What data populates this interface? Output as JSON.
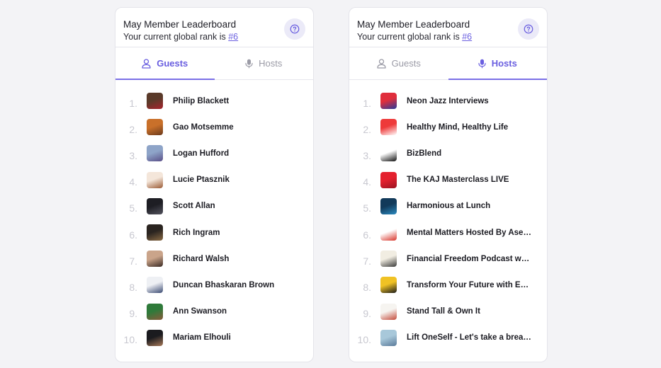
{
  "panels": [
    {
      "title": "May Member Leaderboard",
      "subtitle_prefix": "Your current global rank is ",
      "rank": "#6",
      "tabs": [
        {
          "label": "Guests",
          "icon": "user-icon",
          "active": true
        },
        {
          "label": "Hosts",
          "icon": "microphone-icon",
          "active": false
        }
      ],
      "rows": [
        {
          "rank": "1.",
          "name": "Philip Blackett",
          "avatar_colors": [
            "#5a3a2a",
            "#a8222c"
          ]
        },
        {
          "rank": "2.",
          "name": "Gao Motsemme",
          "avatar_colors": [
            "#c9702a",
            "#6b3a1c"
          ]
        },
        {
          "rank": "3.",
          "name": "Logan Hufford",
          "avatar_colors": [
            "#8ea4c8",
            "#5a4f88"
          ]
        },
        {
          "rank": "4.",
          "name": "Lucie Ptasznik",
          "avatar_colors": [
            "#f4e6da",
            "#9a5a34"
          ]
        },
        {
          "rank": "5.",
          "name": "Scott Allan",
          "avatar_colors": [
            "#1e1e24",
            "#53535e"
          ]
        },
        {
          "rank": "6.",
          "name": "Rich Ingram",
          "avatar_colors": [
            "#2a2420",
            "#8a6a44"
          ]
        },
        {
          "rank": "7.",
          "name": "Richard Walsh",
          "avatar_colors": [
            "#caa48a",
            "#3a2a24"
          ]
        },
        {
          "rank": "8.",
          "name": "Duncan Bhaskaran Brown",
          "avatar_colors": [
            "#eef0f4",
            "#3a4a72"
          ]
        },
        {
          "rank": "9.",
          "name": "Ann Swanson",
          "avatar_colors": [
            "#2f7a3a",
            "#8a5a3a"
          ]
        },
        {
          "rank": "10.",
          "name": "Mariam Elhouli",
          "avatar_colors": [
            "#1b1b1f",
            "#a87a5a"
          ]
        }
      ]
    },
    {
      "title": "May Member Leaderboard",
      "subtitle_prefix": "Your current global rank is ",
      "rank": "#6",
      "tabs": [
        {
          "label": "Guests",
          "icon": "user-icon",
          "active": false
        },
        {
          "label": "Hosts",
          "icon": "microphone-icon",
          "active": true
        }
      ],
      "rows": [
        {
          "rank": "1.",
          "name": "Neon Jazz Interviews",
          "avatar_colors": [
            "#e02e3c",
            "#2a3a9a"
          ]
        },
        {
          "rank": "2.",
          "name": "Healthy Mind, Healthy Life",
          "avatar_colors": [
            "#ee3a3a",
            "#ffffff"
          ]
        },
        {
          "rank": "3.",
          "name": "BizBlend",
          "avatar_colors": [
            "#ffffff",
            "#111111"
          ]
        },
        {
          "rank": "4.",
          "name": "The KAJ Masterclass LIVE",
          "avatar_colors": [
            "#e4202e",
            "#9a1422"
          ]
        },
        {
          "rank": "5.",
          "name": "Harmonious at Lunch",
          "avatar_colors": [
            "#123a5a",
            "#2a8ac0"
          ]
        },
        {
          "rank": "6.",
          "name": "Mental Matters Hosted By Asekh...",
          "avatar_colors": [
            "#ffffff",
            "#d8342a"
          ]
        },
        {
          "rank": "7.",
          "name": "Financial Freedom Podcast with ...",
          "avatar_colors": [
            "#f1ede2",
            "#3a3a3a"
          ]
        },
        {
          "rank": "8.",
          "name": "Transform Your Future with Eddi...",
          "avatar_colors": [
            "#f0c224",
            "#1a1a1a"
          ]
        },
        {
          "rank": "9.",
          "name": "Stand Tall & Own It",
          "avatar_colors": [
            "#f6f4f0",
            "#c44a3a"
          ]
        },
        {
          "rank": "10.",
          "name": "Lift OneSelf - Let's take a breath ...",
          "avatar_colors": [
            "#a8c8da",
            "#5a7a9a"
          ]
        }
      ]
    }
  ]
}
